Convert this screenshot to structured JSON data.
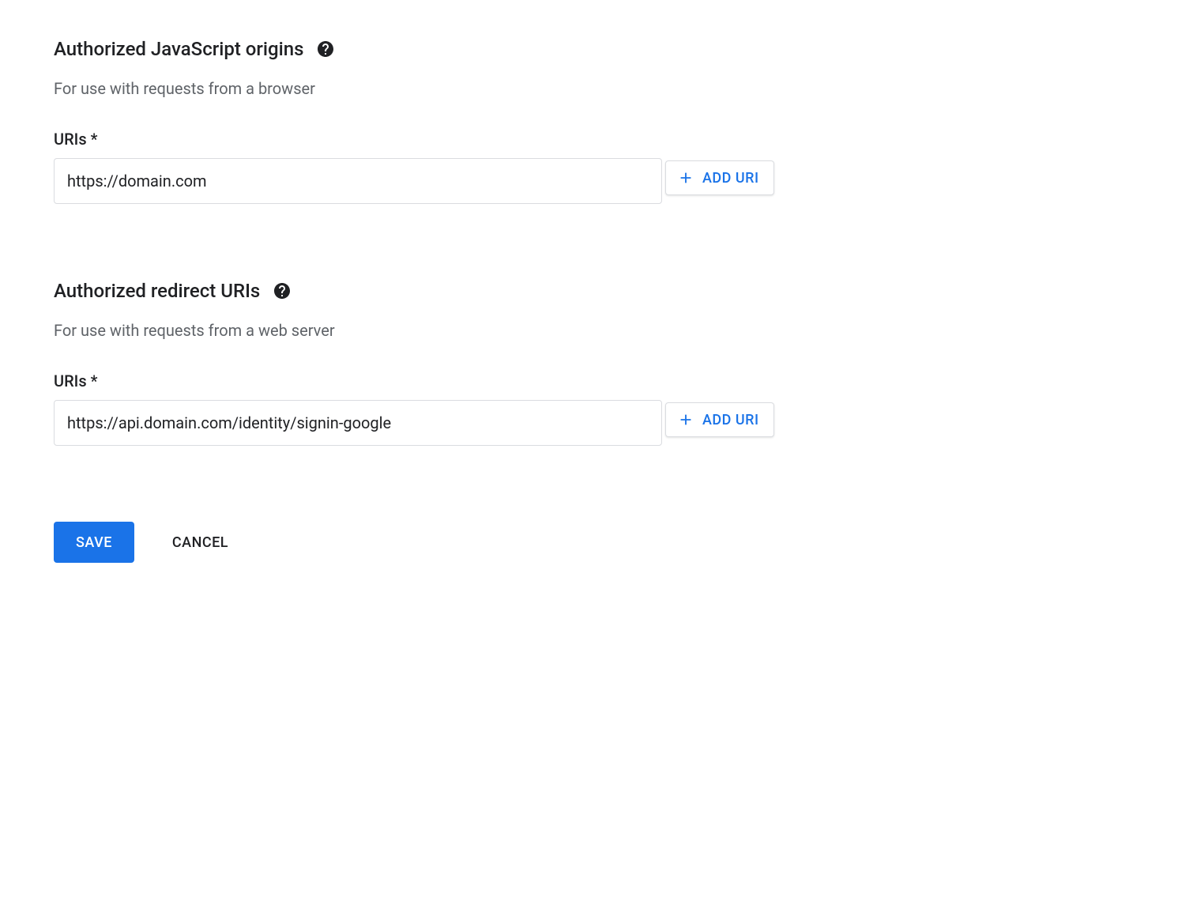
{
  "sections": {
    "js_origins": {
      "title": "Authorized JavaScript origins",
      "subtitle": "For use with requests from a browser",
      "field_label": "URIs *",
      "uri_value": "https://domain.com",
      "add_button_label": "ADD URI"
    },
    "redirect_uris": {
      "title": "Authorized redirect URIs",
      "subtitle": "For use with requests from a web server",
      "field_label": "URIs *",
      "uri_value": "https://api.domain.com/identity/signin-google",
      "add_button_label": "ADD URI"
    }
  },
  "actions": {
    "save_label": "SAVE",
    "cancel_label": "CANCEL"
  }
}
